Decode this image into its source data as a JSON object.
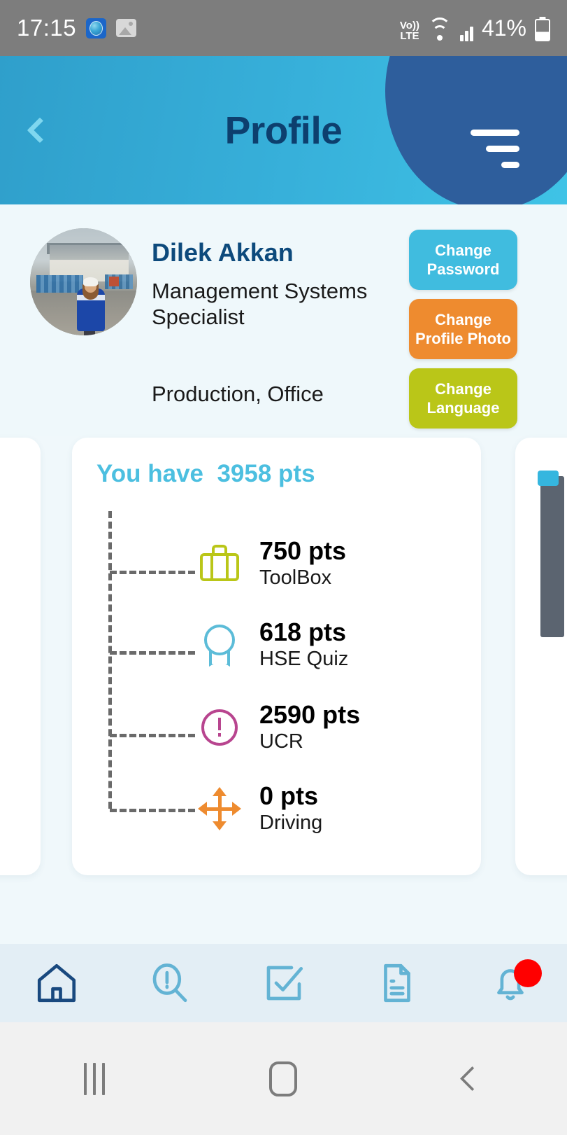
{
  "statusbar": {
    "time": "17:15",
    "volte_top": "Vo))",
    "volte_bottom": "LTE",
    "battery_percent": "41%",
    "app_icon": "globe-app-icon",
    "gallery_icon": "gallery-icon",
    "wifi_icon": "wifi-icon",
    "signal_icon": "signal-bars-icon",
    "battery_icon": "battery-icon"
  },
  "header": {
    "title": "Profile",
    "back_icon": "back-chevron-icon",
    "menu_icon": "menu-filter-icon",
    "colors": {
      "gradient_start": "#2f9fcb",
      "gradient_end": "#3fc3e6",
      "menu_blob": "#2e5e9c",
      "title_color": "#0d3f6e",
      "back_color": "#7fd7ef"
    }
  },
  "profile": {
    "avatar_alt": "user-avatar-photo",
    "name": "Dilek Akkan",
    "job_title": "Management Systems Specialist",
    "department": "Production, Office",
    "buttons": [
      {
        "label": "Change Password",
        "color": "#40bcdf",
        "name": "change-password-button"
      },
      {
        "label": "Change Profile Photo",
        "color": "#ee8b2f",
        "name": "change-profile-photo-button"
      },
      {
        "label": "Change Language",
        "color": "#bac618",
        "name": "change-language-button"
      }
    ]
  },
  "points_card": {
    "headline_prefix": "You have",
    "total": "3958 pts",
    "headline": "You have  3958 pts",
    "headline_color": "#4cbfe0",
    "rows": [
      {
        "value": "750 pts",
        "label": "ToolBox",
        "icon": "toolbox-icon",
        "icon_color": "#bac618"
      },
      {
        "value": "618 pts",
        "label": "HSE Quiz",
        "icon": "award-ribbon-icon",
        "icon_color": "#5cbcd8"
      },
      {
        "value": "2590 pts",
        "label": "UCR",
        "icon": "exclamation-circle-icon",
        "icon_color": "#b8458f"
      },
      {
        "value": "0 pts",
        "label": "Driving",
        "icon": "move-arrows-icon",
        "icon_color": "#ee8b2f"
      }
    ]
  },
  "side_cards": {
    "previous": {
      "name": "leaderboard-card-partial",
      "trophies": [
        {
          "name": "gold-trophy-icon",
          "color": "#f0b619"
        },
        {
          "name": "silver-trophy-icon",
          "color": "#b8b8b8"
        },
        {
          "name": "bronze-trophy-icon",
          "color": "#c2731a"
        }
      ]
    },
    "next": {
      "name": "chart-card-partial",
      "bar_color": "#5b6470",
      "cap_color": "#35b6df"
    }
  },
  "bottom_nav": {
    "items": [
      {
        "name": "nav-home",
        "icon": "home-icon",
        "color": "#19497f",
        "badge": ""
      },
      {
        "name": "nav-report",
        "icon": "search-alert-icon",
        "color": "#63b3d4",
        "badge": ""
      },
      {
        "name": "nav-tasks",
        "icon": "checkbox-edit-icon",
        "color": "#63b3d4",
        "badge": ""
      },
      {
        "name": "nav-documents",
        "icon": "document-icon",
        "color": "#63b3d4",
        "badge": ""
      },
      {
        "name": "nav-notifications",
        "icon": "bell-icon",
        "color": "#63b3d4",
        "badge": "unread-dot"
      }
    ],
    "badge_color": "#ff0000"
  },
  "system_nav": {
    "recents": "recents-icon",
    "home": "home-square-icon",
    "back": "back-icon"
  }
}
